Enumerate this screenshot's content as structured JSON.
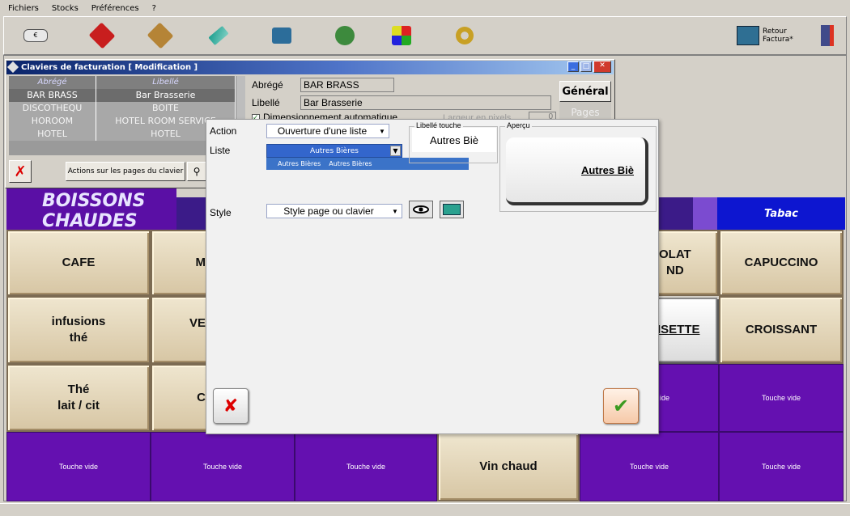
{
  "menu": [
    "Fichiers",
    "Stocks",
    "Préférences",
    "?"
  ],
  "toolbar": {
    "icons": [
      "ticket-icon",
      "box-red-icon",
      "box-brown-icon",
      "card-icon",
      "cash-register-icon",
      "user-icon",
      "grid-icon",
      "gears-icon"
    ],
    "retour_line1": "Retour",
    "retour_line2": "Factura*"
  },
  "window": {
    "title": "Claviers de facturation  [ Modification ]",
    "list_header": {
      "abrege": "Abrégé",
      "libelle": "Libellé"
    },
    "rows": [
      {
        "abrege": "BAR BRASS",
        "libelle": "Bar Brasserie"
      },
      {
        "abrege": "DISCOTHEQU",
        "libelle": "BOITE"
      },
      {
        "abrege": "HOROOM",
        "libelle": "HOTEL ROOM SERVICE"
      },
      {
        "abrege": "HOTEL",
        "libelle": "HOTEL"
      }
    ],
    "abrege_label": "Abrégé",
    "abrege_value": "BAR BRASS",
    "libelle_label": "Libellé",
    "libelle_value": "Bar Brasserie",
    "dim_auto_label": "Dimensionnement automatique",
    "largeur_label": "Largeur en pixels",
    "largeur_value": "0",
    "general_label": "Général",
    "pages_label": "Pages",
    "actions_label": "Actions sur les pages du clavier"
  },
  "dialog": {
    "action_label": "Action",
    "action_value": "Ouverture d'une liste",
    "liste_label": "Liste",
    "liste_value": "Autres Bières",
    "liste_drop_col1": "Autres Bières",
    "liste_drop_col2": "Autres Bières",
    "libelle_touche_title": "Libellé touche",
    "libelle_touche_value": "Autres Biè",
    "apercu_title": "Aperçu",
    "apercu_key": "Autres Biè",
    "style_label": "Style",
    "style_value": "Style page ou clavier"
  },
  "keyboard": {
    "tab_boissons": "BOISSONS CHAUDES",
    "tab_tabac": "Tabac",
    "keys": {
      "cafe": "CAFE",
      "m_partial": "M",
      "olat_nd": "OLAT\nND",
      "capuccino": "CAPUCCINO",
      "infusions": "infusions\nthé",
      "ve_partial": "VE",
      "noisette_partial": "ISETTE",
      "croissant": "CROISSANT",
      "the_lait": "Thé\nlait / cit",
      "c_partial": "C",
      "vide_partial": "ide",
      "vin_chaud": "Vin chaud",
      "empty": "Touche vide"
    }
  }
}
